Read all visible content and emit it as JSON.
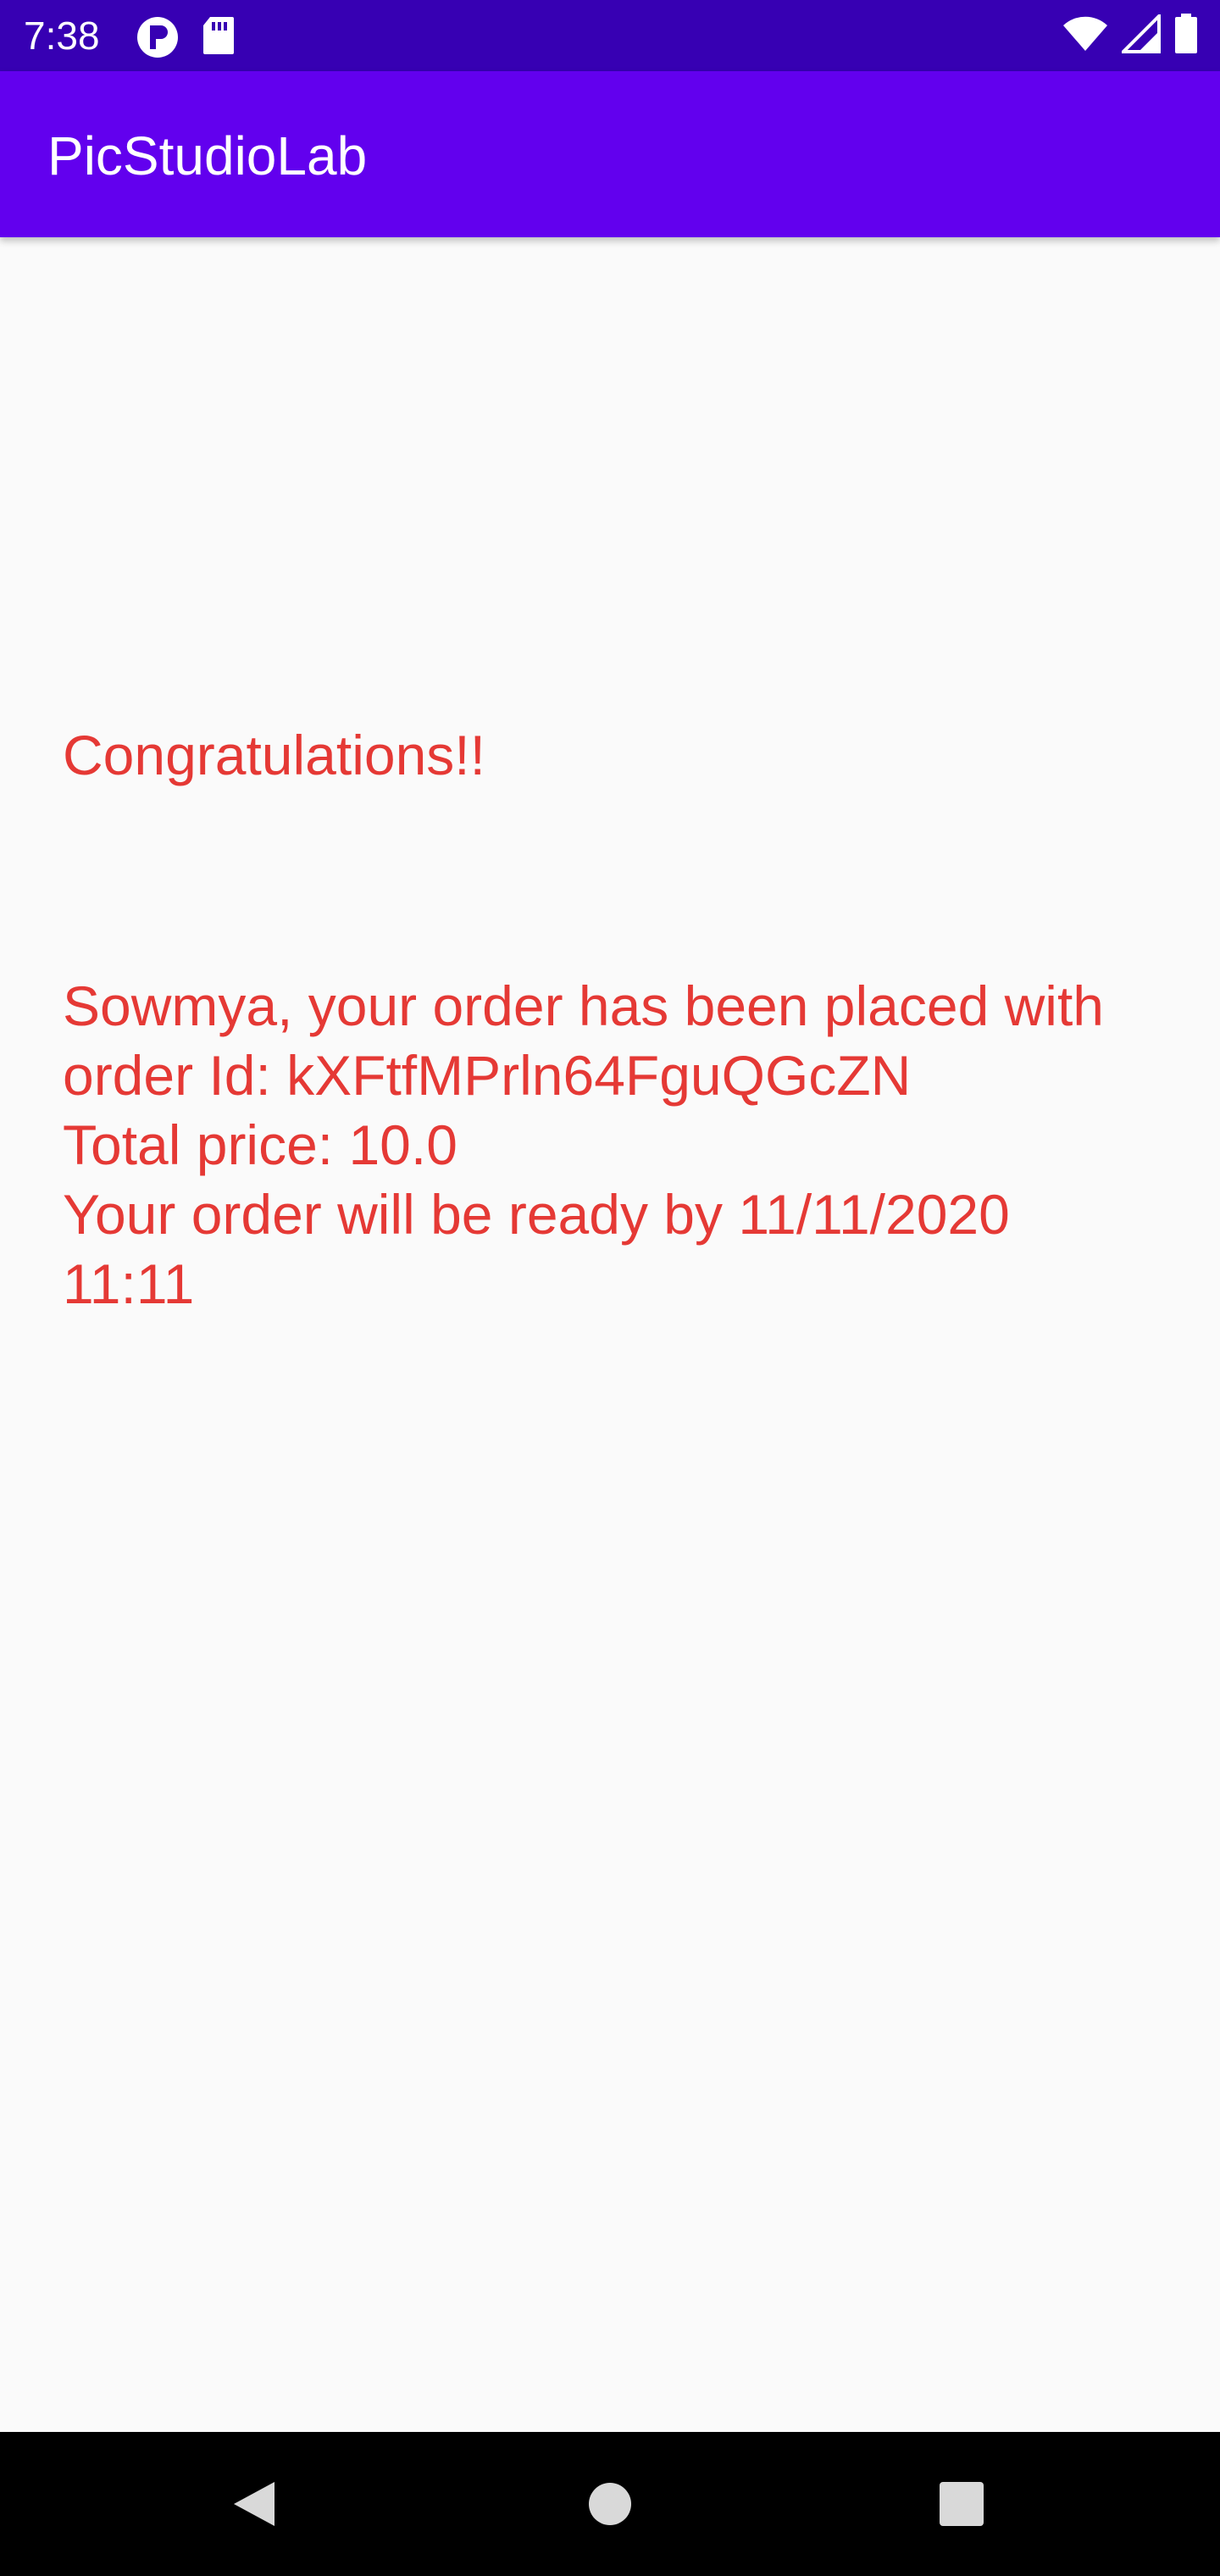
{
  "status_bar": {
    "time": "7:38",
    "icons_left": [
      "p-badge-icon",
      "sd-card-icon"
    ],
    "icons_right": [
      "wifi-icon",
      "cell-signal-icon",
      "battery-icon"
    ]
  },
  "app_bar": {
    "title": "PicStudioLab"
  },
  "main": {
    "congrats_text": "Congratulations!!",
    "order_lines": [
      "Sowmya, your order has been placed with",
      "order Id: kXFtfMPrln64FguQGcZN",
      "Total price: 10.0",
      "Your order will be ready by 11/11/2020",
      "11:11"
    ]
  },
  "nav_bar": {
    "buttons": [
      "back-icon",
      "home-icon",
      "recents-icon"
    ]
  },
  "colors": {
    "status_bar": "#3700b3",
    "app_bar": "#6200ee",
    "message_text": "#e53935",
    "background": "#fafafa",
    "nav_bar": "#000000"
  }
}
